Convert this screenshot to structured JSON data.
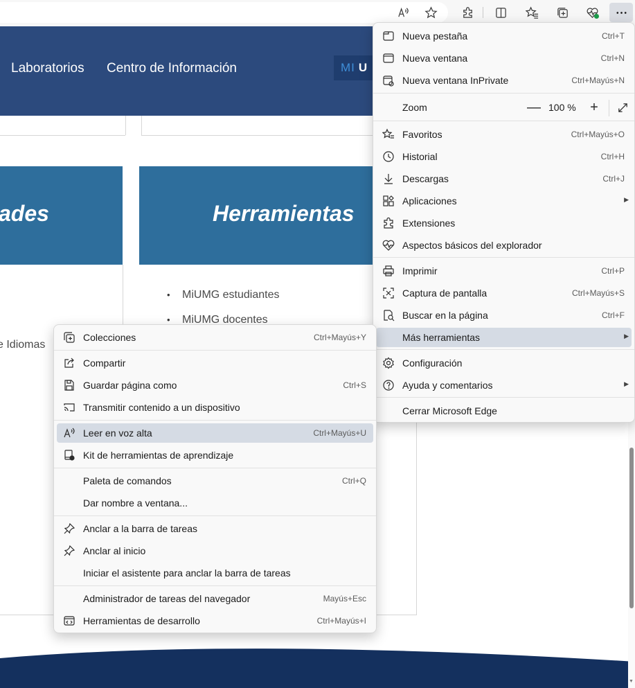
{
  "toolbar": {
    "icons": [
      "read-aloud-icon",
      "favorite-star-icon",
      "extensions-icon",
      "split-screen-icon",
      "favorites-icon",
      "collections-icon",
      "browser-essentials-icon",
      "more-menu-icon"
    ]
  },
  "page": {
    "nav_links": [
      "Laboratorios",
      "Centro de Información"
    ],
    "logo_prefix": "MI",
    "logo_suffix": "U",
    "card_left_title": "ades",
    "card_right_title": "Herramientas",
    "bullets": [
      "MiUMG estudiantes",
      "MiUMG docentes"
    ],
    "left_fragment": "e Idiomas"
  },
  "main_menu": {
    "items": [
      {
        "label": "Nueva pestaña",
        "shortcut": "Ctrl+T",
        "icon": "new-tab-icon"
      },
      {
        "label": "Nueva ventana",
        "shortcut": "Ctrl+N",
        "icon": "new-window-icon"
      },
      {
        "label": "Nueva ventana InPrivate",
        "shortcut": "Ctrl+Mayús+N",
        "icon": "inprivate-icon"
      },
      {
        "label": "Favoritos",
        "shortcut": "Ctrl+Mayús+O",
        "icon": "favorites-icon"
      },
      {
        "label": "Historial",
        "shortcut": "Ctrl+H",
        "icon": "history-icon"
      },
      {
        "label": "Descargas",
        "shortcut": "Ctrl+J",
        "icon": "download-icon"
      },
      {
        "label": "Aplicaciones",
        "shortcut": "",
        "icon": "apps-icon"
      },
      {
        "label": "Extensiones",
        "shortcut": "",
        "icon": "extensions-icon"
      },
      {
        "label": "Aspectos básicos del explorador",
        "shortcut": "",
        "icon": "browser-essentials-icon"
      },
      {
        "label": "Imprimir",
        "shortcut": "Ctrl+P",
        "icon": "print-icon"
      },
      {
        "label": "Captura de pantalla",
        "shortcut": "Ctrl+Mayús+S",
        "icon": "screenshot-icon"
      },
      {
        "label": "Buscar en la página",
        "shortcut": "Ctrl+F",
        "icon": "find-icon"
      },
      {
        "label": "Más herramientas",
        "shortcut": "",
        "icon": ""
      },
      {
        "label": "Configuración",
        "shortcut": "",
        "icon": "settings-icon"
      },
      {
        "label": "Ayuda y comentarios",
        "shortcut": "",
        "icon": "help-icon"
      },
      {
        "label": "Cerrar Microsoft Edge",
        "shortcut": "",
        "icon": ""
      }
    ],
    "zoom": {
      "label": "Zoom",
      "minus": "—",
      "value": "100 %",
      "plus": "+",
      "fullscreen_icon": "fullscreen-icon"
    }
  },
  "sub_menu": {
    "items": [
      {
        "label": "Colecciones",
        "shortcut": "Ctrl+Mayús+Y",
        "icon": "collections-icon"
      },
      {
        "label": "Compartir",
        "shortcut": "",
        "icon": "share-icon"
      },
      {
        "label": "Guardar página como",
        "shortcut": "Ctrl+S",
        "icon": "save-page-icon"
      },
      {
        "label": "Transmitir contenido a un dispositivo",
        "shortcut": "",
        "icon": "cast-icon"
      },
      {
        "label": "Leer en voz alta",
        "shortcut": "Ctrl+Mayús+U",
        "icon": "read-aloud-icon"
      },
      {
        "label": "Kit de herramientas de aprendizaje",
        "shortcut": "",
        "icon": "learning-toolkit-icon"
      },
      {
        "label": "Paleta de comandos",
        "shortcut": "Ctrl+Q",
        "icon": ""
      },
      {
        "label": "Dar nombre a ventana...",
        "shortcut": "",
        "icon": ""
      },
      {
        "label": "Anclar a la barra de tareas",
        "shortcut": "",
        "icon": "pin-icon"
      },
      {
        "label": "Anclar al inicio",
        "shortcut": "",
        "icon": "pin-icon"
      },
      {
        "label": "Iniciar el asistente para anclar la barra de tareas",
        "shortcut": "",
        "icon": ""
      },
      {
        "label": "Administrador de tareas del navegador",
        "shortcut": "Mayús+Esc",
        "icon": ""
      },
      {
        "label": "Herramientas de desarrollo",
        "shortcut": "Ctrl+Mayús+I",
        "icon": "dev-tools-icon"
      }
    ]
  },
  "colors": {
    "nav": "#2c4a7d",
    "card": "#2e6e9c",
    "highlight": "#d5dbe4",
    "wave": "#14305e"
  }
}
